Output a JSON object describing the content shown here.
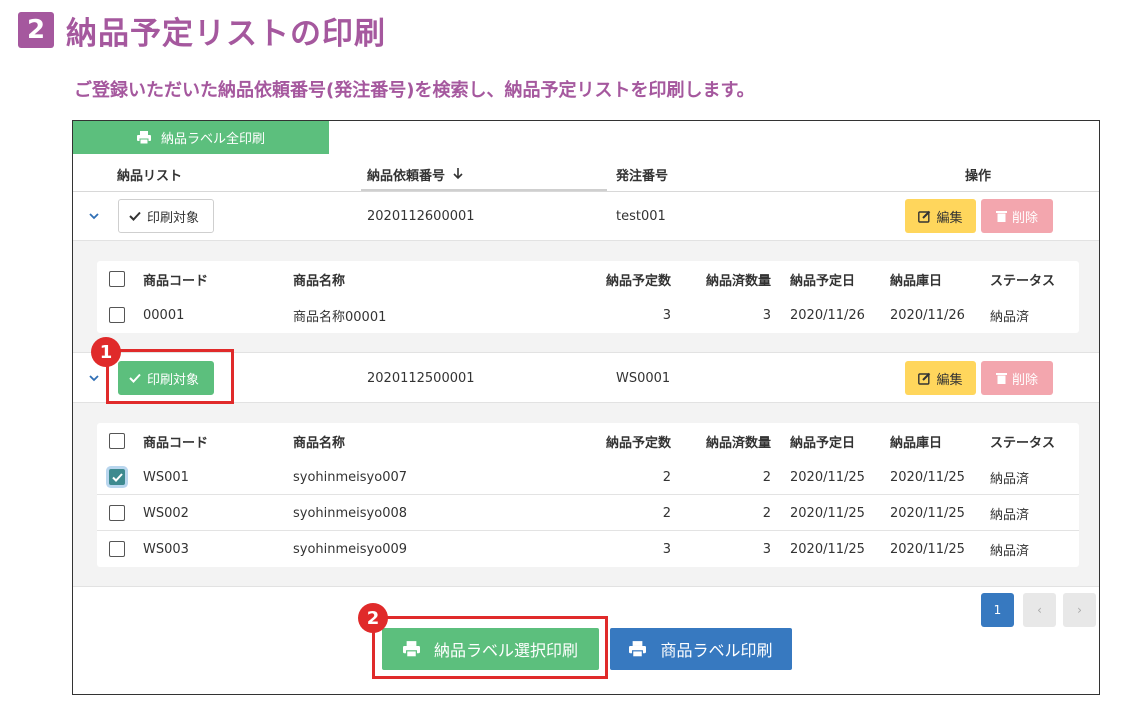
{
  "heading": {
    "step": "2",
    "title": "納品予定リストの印刷"
  },
  "subtitle": "ご登録いただいた納品依頼番号(発注番号)を検索し、納品予定リストを印刷します。",
  "toolbar": {
    "print_all_label": "納品ラベル全印刷"
  },
  "columns": {
    "list": "納品リスト",
    "request_no": "納品依頼番号",
    "order_no": "発注番号",
    "actions": "操作"
  },
  "inner_columns": {
    "code": "商品コード",
    "name": "商品名称",
    "planned_qty": "納品予定数",
    "delivered_qty": "納品済数量",
    "planned_date": "納品予定日",
    "warehouse_date": "納品庫日",
    "status": "ステータス"
  },
  "orders": [
    {
      "toggle_label": "印刷対象",
      "request_no": "2020112600001",
      "order_no": "test001",
      "edit_label": "編集",
      "delete_label": "削除",
      "items": [
        {
          "code": "00001",
          "name": "商品名称00001",
          "planned_qty": "3",
          "delivered_qty": "3",
          "planned_date": "2020/11/26",
          "warehouse_date": "2020/11/26",
          "status": "納品済",
          "checked": false
        }
      ]
    },
    {
      "toggle_label": "印刷対象",
      "request_no": "2020112500001",
      "order_no": "WS0001",
      "edit_label": "編集",
      "delete_label": "削除",
      "items": [
        {
          "code": "WS001",
          "name": "syohinmeisyo007",
          "planned_qty": "2",
          "delivered_qty": "2",
          "planned_date": "2020/11/25",
          "warehouse_date": "2020/11/25",
          "status": "納品済",
          "checked": true
        },
        {
          "code": "WS002",
          "name": "syohinmeisyo008",
          "planned_qty": "2",
          "delivered_qty": "2",
          "planned_date": "2020/11/25",
          "warehouse_date": "2020/11/25",
          "status": "納品済",
          "checked": false
        },
        {
          "code": "WS003",
          "name": "syohinmeisyo009",
          "planned_qty": "3",
          "delivered_qty": "3",
          "planned_date": "2020/11/25",
          "warehouse_date": "2020/11/25",
          "status": "納品済",
          "checked": false
        }
      ]
    }
  ],
  "pagination": {
    "current": "1",
    "prev": "‹",
    "next": "›"
  },
  "footer": {
    "select_print_label": "納品ラベル選択印刷",
    "product_print_label": "商品ラベル印刷"
  },
  "markers": {
    "m1": "1",
    "m2": "2"
  },
  "colors": {
    "accent": "#a5589e",
    "green": "#5cbf7d",
    "blue": "#3779c0",
    "yellow": "#ffd65c",
    "pink": "#f3a6ae",
    "highlight": "#e02a2a"
  }
}
